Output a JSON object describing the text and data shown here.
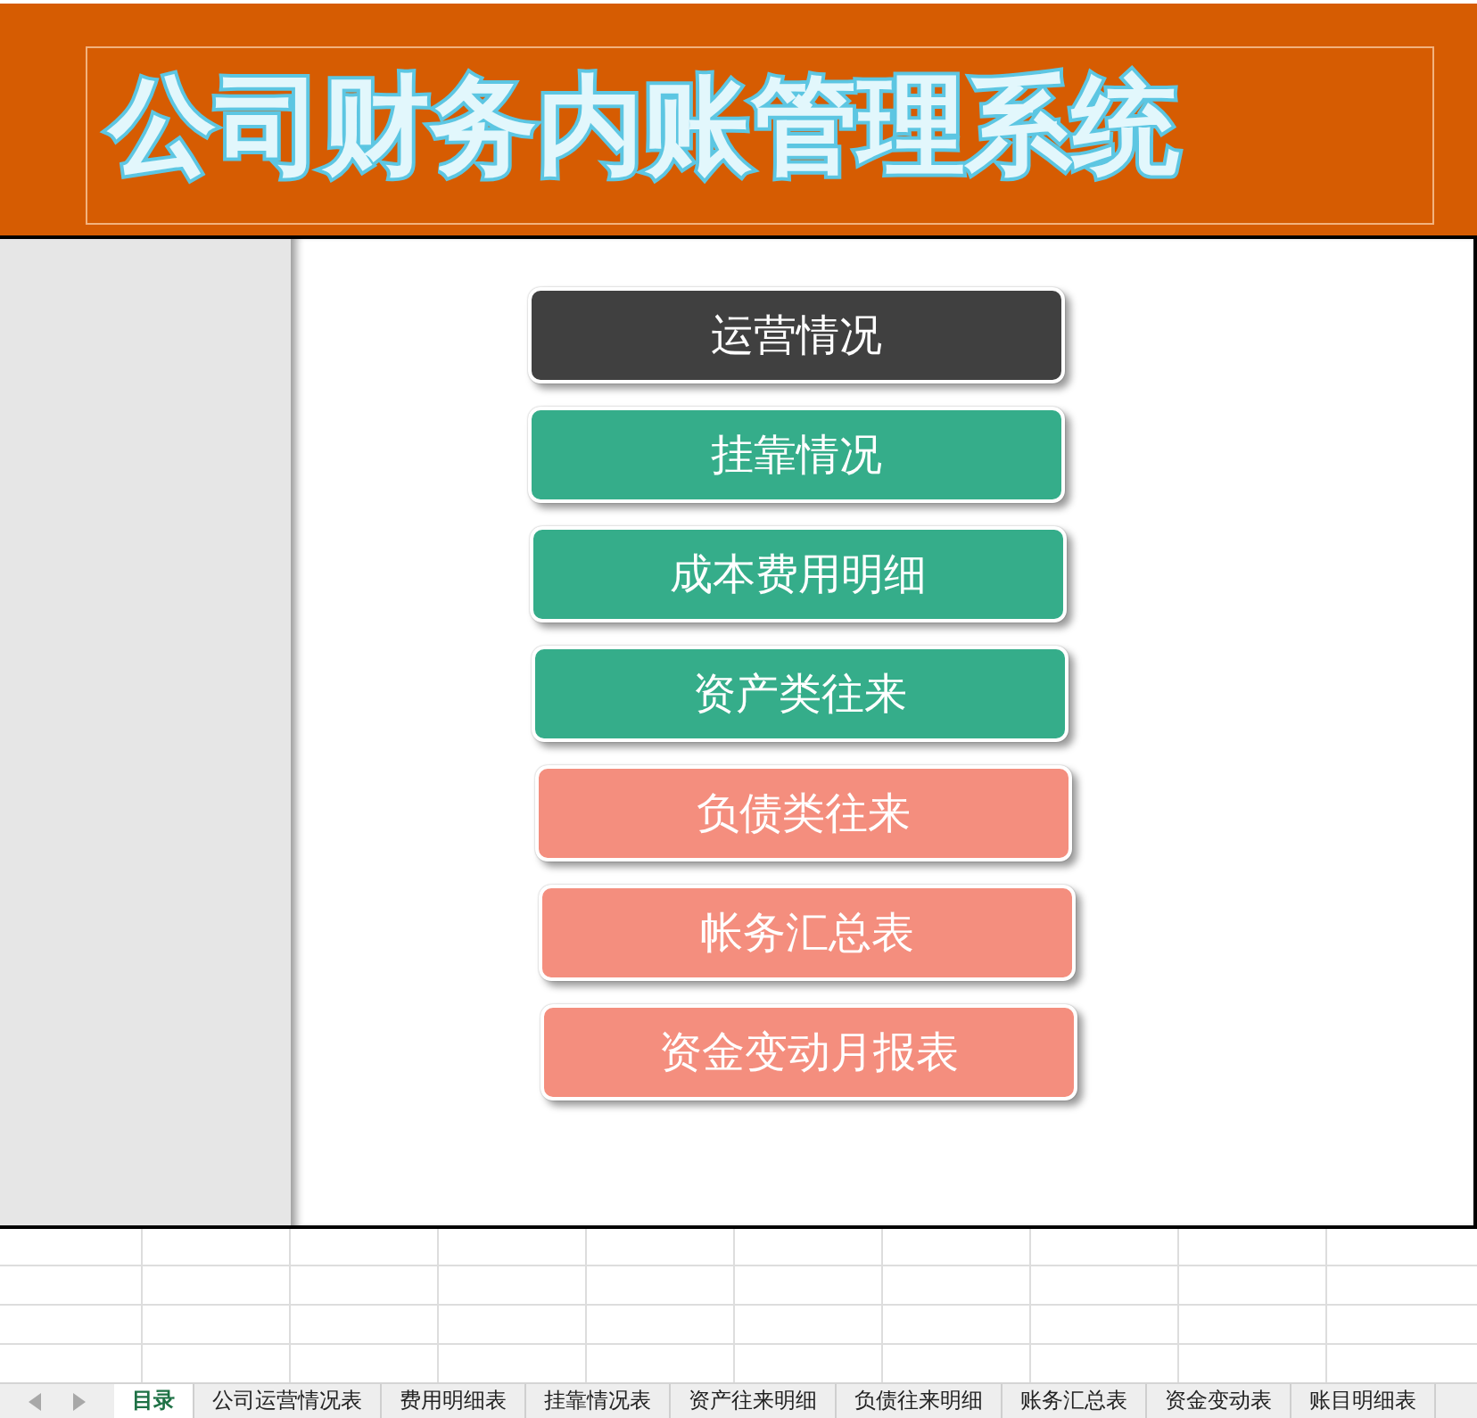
{
  "header": {
    "title": "公司财务内账管理系统"
  },
  "menu_buttons": [
    {
      "label": "运营情况",
      "color": "#404040"
    },
    {
      "label": "挂靠情况",
      "color": "#35ad8a"
    },
    {
      "label": "成本费用明细",
      "color": "#35ad8a"
    },
    {
      "label": "资产类往来",
      "color": "#35ad8a"
    },
    {
      "label": "负债类往来",
      "color": "#f48e7e"
    },
    {
      "label": "帐务汇总表",
      "color": "#f48e7e"
    },
    {
      "label": "资金变动月报表",
      "color": "#f48e7e"
    }
  ],
  "sheet_tabs": [
    {
      "label": "目录",
      "selected": true
    },
    {
      "label": "公司运营情况表",
      "selected": false
    },
    {
      "label": "费用明细表",
      "selected": false
    },
    {
      "label": "挂靠情况表",
      "selected": false
    },
    {
      "label": "资产往来明细",
      "selected": false
    },
    {
      "label": "负债往来明细",
      "selected": false
    },
    {
      "label": "账务汇总表",
      "selected": false
    },
    {
      "label": "资金变动表",
      "selected": false
    },
    {
      "label": "账目明细表",
      "selected": false
    }
  ]
}
